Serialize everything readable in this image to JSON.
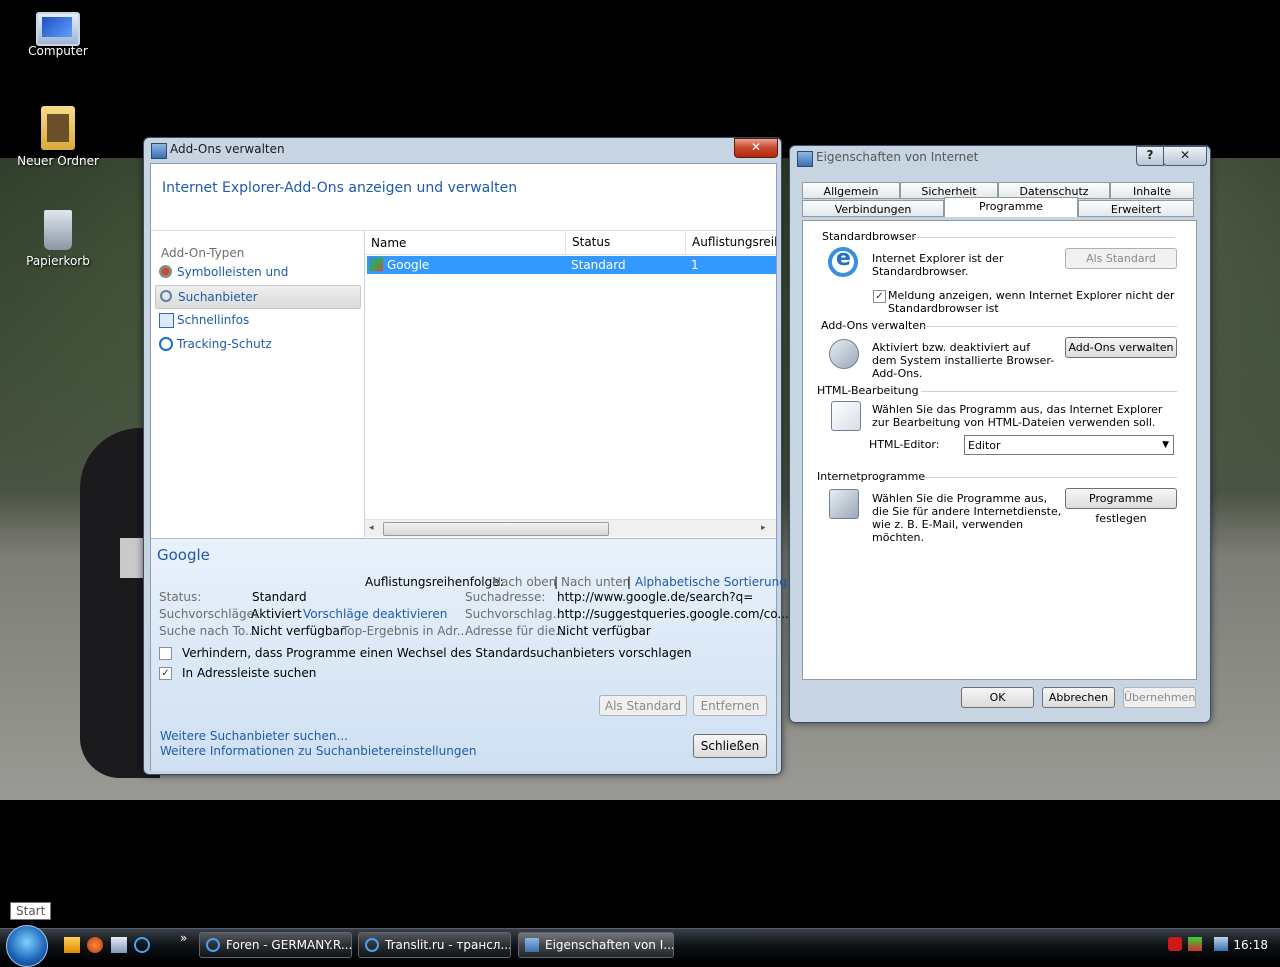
{
  "desktop": {
    "icons": [
      {
        "label": "Computer"
      },
      {
        "label": "Neuer Ordner"
      },
      {
        "label": "Papierkorb"
      }
    ]
  },
  "addons": {
    "title": "Add-Ons verwalten",
    "close_glyph": "✕",
    "header": "Internet Explorer-Add-Ons anzeigen und verwalten",
    "types_caption": "Add-On-Typen",
    "types": [
      {
        "label": "Symbolleisten und Erweiterungen"
      },
      {
        "label": "Suchanbieter"
      },
      {
        "label": "Schnellinfos"
      },
      {
        "label": "Tracking-Schutz"
      }
    ],
    "columns": {
      "name": "Name",
      "status": "Status",
      "order": "Auflistungsreihe"
    },
    "rows": [
      {
        "name": "Google",
        "status": "Standard",
        "order": "1"
      }
    ],
    "details": {
      "name": "Google",
      "order_label": "Auflistungsreihenfolge:",
      "order_up": "Nach oben",
      "sep": "|",
      "order_down": "Nach unten",
      "order_alpha": "Alphabetische Sortierung",
      "status_label": "Status:",
      "status_value": "Standard",
      "search_addr_label": "Suchadresse:",
      "search_addr_value": "http://www.google.de/search?q=",
      "suggest_label": "Suchvorschläge:",
      "suggest_value": "Aktiviert",
      "suggest_link": "Vorschläge deaktivieren",
      "suggest_addr_label": "Suchvorschlag...",
      "suggest_addr_value": "http://suggestqueries.google.com/co...",
      "search_to_label": "Suche nach To...",
      "search_to_value": "Nicht verfügbar",
      "top_result_label": "Top-Ergebnis in Adr...",
      "addr_for_label": "Adresse für die...",
      "addr_for_value": "Nicht verfügbar",
      "prevent_label": "Verhindern, dass Programme einen Wechsel des Standardsuchanbieters vorschlagen",
      "prevent_checked": false,
      "addrbar_label": "In Adressleiste suchen",
      "addrbar_checked": true,
      "set_default": "Als Standard",
      "remove": "Entfernen",
      "more_providers": "Weitere Suchanbieter suchen...",
      "more_info": "Weitere Informationen zu Suchanbietereinstellungen",
      "close": "Schließen"
    }
  },
  "inetopt": {
    "title": "Eigenschaften von Internet",
    "help_glyph": "?",
    "close_glyph": "✕",
    "tabs_row1": [
      "Allgemein",
      "Sicherheit",
      "Datenschutz",
      "Inhalte"
    ],
    "tabs_row2": [
      "Verbindungen",
      "Programme",
      "Erweitert"
    ],
    "active_tab": "Programme",
    "standardbrowser": {
      "heading": "Standardbrowser",
      "text": "Internet Explorer ist der Standardbrowser.",
      "button": "Als Standard",
      "check_label": "Meldung anzeigen, wenn Internet Explorer nicht der Standardbrowser ist",
      "checked": true
    },
    "addons": {
      "heading": "Add-Ons verwalten",
      "text": "Aktiviert bzw. deaktiviert auf dem System installierte Browser-Add-Ons.",
      "button": "Add-Ons verwalten"
    },
    "html": {
      "heading": "HTML-Bearbeitung",
      "text": "Wählen Sie das Programm aus, das Internet Explorer zur Bearbeitung von HTML-Dateien verwenden soll.",
      "editor_label": "HTML-Editor:",
      "editor_value": "Editor"
    },
    "programs": {
      "heading": "Internetprogramme",
      "text": "Wählen Sie die Programme aus, die Sie für andere Internetdienste, wie z. B. E-Mail, verwenden möchten.",
      "button": "Programme festlegen"
    },
    "ok": "OK",
    "cancel": "Abbrechen",
    "apply": "Übernehmen"
  },
  "taskbar": {
    "tooltip": "Start",
    "overflow": "»",
    "buttons": [
      {
        "label": "Foren - GERMANY.R..."
      },
      {
        "label": "Translit.ru - трансл..."
      },
      {
        "label": "Eigenschaften von I..."
      }
    ],
    "clock": "16:18"
  }
}
